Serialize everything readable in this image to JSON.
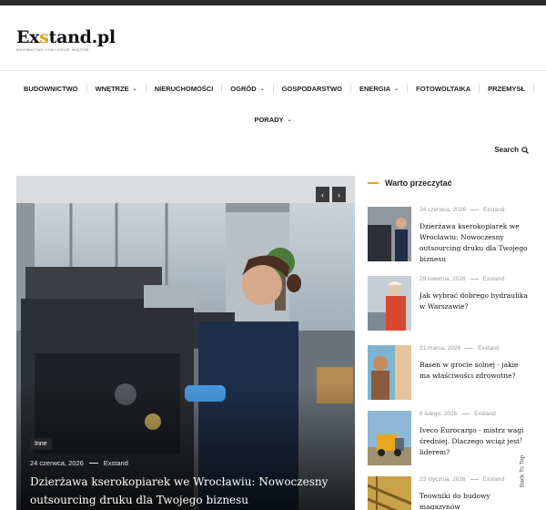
{
  "header": {
    "logo_pre": "Ex",
    "logo_o": "s",
    "logo_post": "tand.pl",
    "logo_tagline": "BUDOWNICTWO, DOM I OGRÓD, WNĘTRZE"
  },
  "nav": {
    "items": [
      {
        "label": "BUDOWNICTWO",
        "has_dropdown": false
      },
      {
        "label": "WNĘTRZE",
        "has_dropdown": true
      },
      {
        "label": "NIERUCHOMOŚCI",
        "has_dropdown": false
      },
      {
        "label": "OGRÓD",
        "has_dropdown": true
      },
      {
        "label": "GOSPODARSTWO",
        "has_dropdown": false
      },
      {
        "label": "ENERGIA",
        "has_dropdown": true
      },
      {
        "label": "FOTOWOLTAIKA",
        "has_dropdown": false
      },
      {
        "label": "PRZEMYSŁ",
        "has_dropdown": false
      },
      {
        "label": "PORADY",
        "has_dropdown": true
      }
    ]
  },
  "search": {
    "label": "Search",
    "icon": "search-icon"
  },
  "slider": {
    "category": "Inne",
    "date": "24 czerwca, 2026",
    "author": "Exstand",
    "title": "Dzierżawa kserokopiarek we Wrocławiu: Nowoczesny outsourcing druku dla Twojego biznesu",
    "prev_icon": "chevron-left-icon",
    "next_icon": "chevron-right-icon"
  },
  "sidebar": {
    "heading": "Warto przeczytać",
    "accent_color": "#e2a11a",
    "posts": [
      {
        "date": "24 czerwca, 2026",
        "author": "Exstand",
        "title": "Dzierżawa kserokopiarek we Wrocławiu: Nowoczesny outsourcing druku dla Twojego biznesu"
      },
      {
        "date": "29 kwietnia, 2026",
        "author": "Exstand",
        "title": "Jak wybrać dobrego hydraulika w Warszawie?"
      },
      {
        "date": "31 marca, 2026",
        "author": "Exstand",
        "title": "Basen w grocie solnej - jakie ma właściwości zdrowotne?"
      },
      {
        "date": "8 lutego, 2026",
        "author": "Exstand",
        "title": "Iveco Eurocargo - mistrz wagi średniej. Dlaczego wciąż jest liderem?"
      },
      {
        "date": "23 stycznia, 2026",
        "author": "Exstand",
        "title": "Teowniki do budowy magazynów"
      }
    ]
  },
  "back_to_top": {
    "label": "Back To Top",
    "icon": "arrow-up-icon"
  }
}
